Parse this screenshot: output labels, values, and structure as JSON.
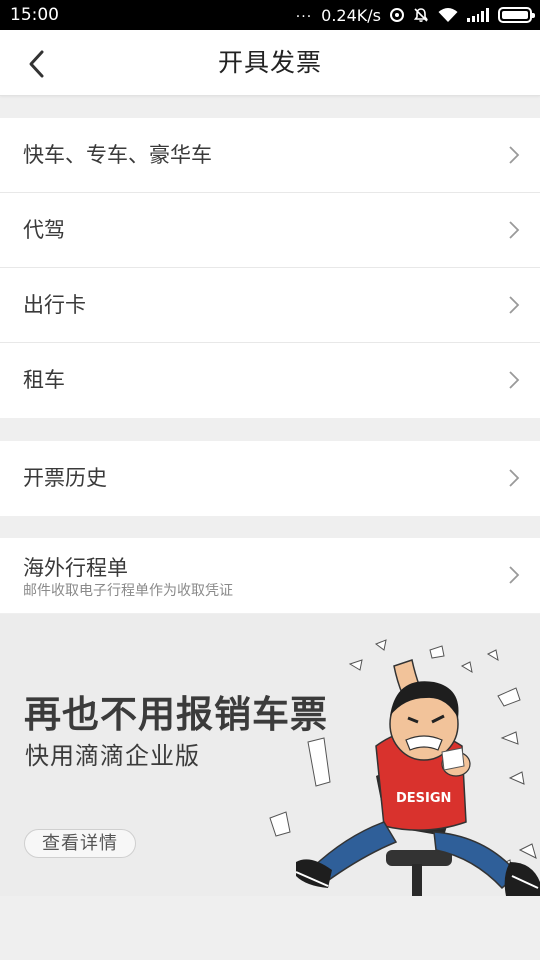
{
  "status_bar": {
    "time": "15:00",
    "dots": "...",
    "speed": "0.24K/s"
  },
  "nav": {
    "title": "开具发票"
  },
  "groups": [
    {
      "items": [
        {
          "label": "快车、专车、豪华车"
        },
        {
          "label": "代驾"
        },
        {
          "label": "出行卡"
        },
        {
          "label": "租车"
        }
      ]
    },
    {
      "items": [
        {
          "label": "开票历史"
        }
      ]
    },
    {
      "items": [
        {
          "label": "海外行程单",
          "sublabel": "邮件收取电子行程单作为收取凭证"
        }
      ]
    }
  ],
  "banner": {
    "title": "再也不用报销车票",
    "subtitle": "快用滴滴企业版",
    "button_label": "查看详情",
    "shirt_text": "DESIGN"
  },
  "colors": {
    "status_bar_bg": "#000000",
    "page_bg": "#efefef",
    "shirt_red": "#d9322d",
    "jeans_blue": "#2f5f99"
  }
}
